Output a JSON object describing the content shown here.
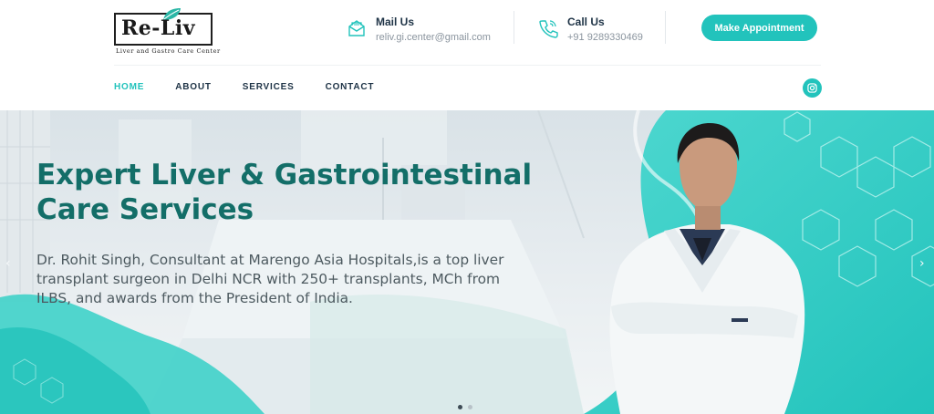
{
  "brand": {
    "logo_text": "Re-Liv",
    "tagline": "Liver and Gastro Care Center"
  },
  "contact": {
    "mail_label": "Mail Us",
    "mail_value": "reliv.gi.center@gmail.com",
    "call_label": "Call Us",
    "call_value": "+91 9289330469"
  },
  "cta": {
    "appointment_label": "Make Appointment"
  },
  "nav": {
    "items": [
      {
        "label": "HOME",
        "active": true
      },
      {
        "label": "ABOUT",
        "active": false
      },
      {
        "label": "SERVICES",
        "active": false
      },
      {
        "label": "CONTACT",
        "active": false
      }
    ],
    "social_icon": "instagram-icon"
  },
  "hero": {
    "title_line1": "Expert Liver & Gastrointestinal",
    "title_line2": "Care Services",
    "description": "Dr. Rohit Singh, Consultant at Marengo Asia Hospitals,is a top liver transplant surgeon in Delhi NCR with 250+ transplants, MCh from ILBS, and awards from the President of India.",
    "prev_arrow": "‹",
    "next_arrow": "›",
    "slide_count": 2,
    "active_slide": 1
  },
  "colors": {
    "accent": "#22c3bc",
    "hero_title": "#136e68",
    "nav_text": "#1e3346",
    "muted": "#8a949e"
  }
}
